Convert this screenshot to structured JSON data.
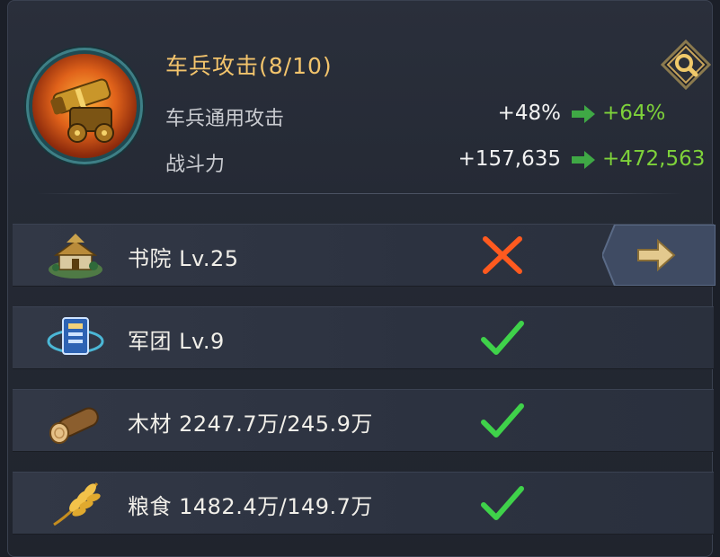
{
  "header": {
    "title": "车兵攻击(8/10)",
    "icon": "cannon-icon",
    "stats": [
      {
        "label": "车兵通用攻击",
        "current": "+48%",
        "next": "+64%"
      },
      {
        "label": "战斗力",
        "current": "+157,635",
        "next": "+472,563"
      }
    ]
  },
  "requirements": [
    {
      "icon": "academy-building-icon",
      "label": "书院 Lv.25",
      "status": "unmet",
      "has_go_button": true
    },
    {
      "icon": "legion-banner-icon",
      "label": "军团 Lv.9",
      "status": "met"
    },
    {
      "icon": "wood-log-icon",
      "label": "木材 2247.7万/245.9万",
      "status": "met"
    },
    {
      "icon": "wheat-icon",
      "label": "粮食 1482.4万/149.7万",
      "status": "met"
    }
  ],
  "colors": {
    "title": "#f3c46c",
    "increase": "#7ed23a",
    "check": "#3fd24a",
    "cross": "#ff5a1f"
  }
}
